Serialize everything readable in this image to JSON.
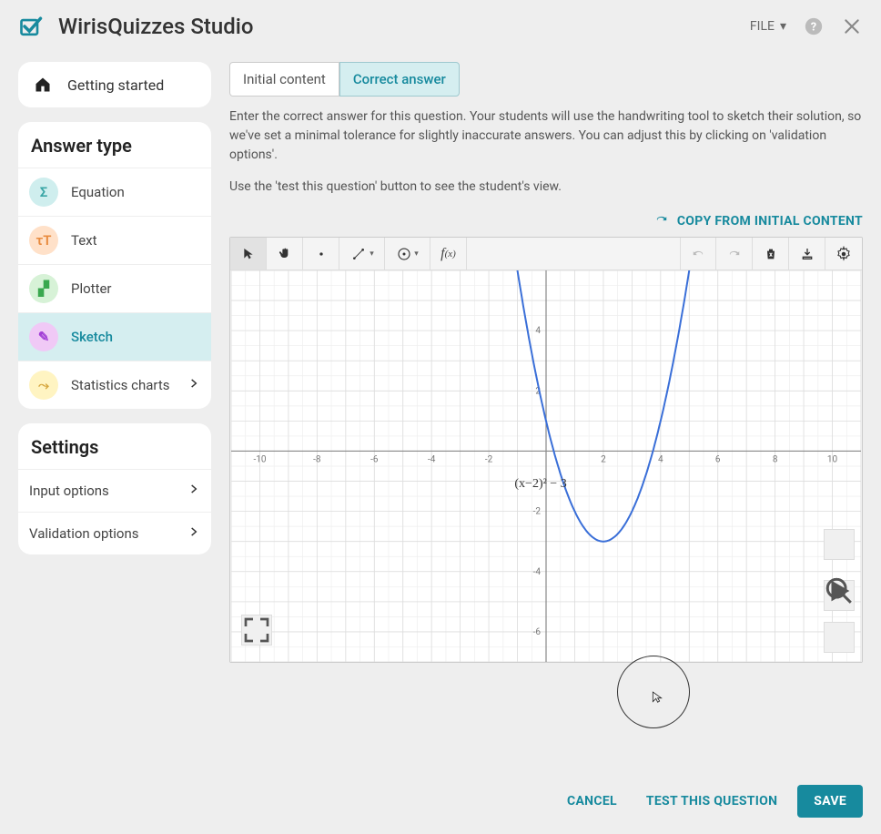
{
  "app_title": "WirisQuizzes Studio",
  "header": {
    "file_label": "FILE"
  },
  "sidebar": {
    "getting_started": "Getting started",
    "answer_type_header": "Answer type",
    "answer_types": [
      {
        "label": "Equation",
        "icon_bg": "#cfeeee",
        "icon_fg": "#3aa6a6",
        "glyph": "Σ"
      },
      {
        "label": "Text",
        "icon_bg": "#ffe1c9",
        "icon_fg": "#e88b3f",
        "glyph": "τT"
      },
      {
        "label": "Plotter",
        "icon_bg": "#d7f2d7",
        "icon_fg": "#3aa84f",
        "glyph": "▞"
      },
      {
        "label": "Sketch",
        "icon_bg": "#f0c9f6",
        "icon_fg": "#a23fd6",
        "glyph": "✎"
      },
      {
        "label": "Statistics charts",
        "icon_bg": "#fff4c2",
        "icon_fg": "#d6a73f",
        "glyph": "⤳"
      }
    ],
    "settings_header": "Settings",
    "settings_items": [
      {
        "label": "Input options"
      },
      {
        "label": "Validation options"
      }
    ]
  },
  "tabs": [
    {
      "label": "Initial content",
      "active": false
    },
    {
      "label": "Correct answer",
      "active": true
    }
  ],
  "instructions": {
    "p1": "Enter the correct answer for this question. Your students will use the handwriting tool to sketch their solution, so we've set a minimal tolerance for slightly inaccurate answers. You can adjust this by clicking on 'validation options'.",
    "p2": "Use the 'test this question' button to see the student's view."
  },
  "copy_label": "COPY FROM INITIAL CONTENT",
  "toolbar": {
    "fx_label": "f(x)"
  },
  "chart_data": {
    "type": "line",
    "title": "",
    "xlabel": "",
    "ylabel": "",
    "xlim": [
      -11,
      11
    ],
    "ylim": [
      -7,
      6
    ],
    "x_ticks": [
      -10,
      -8,
      -6,
      -4,
      -2,
      2,
      4,
      6,
      8,
      10
    ],
    "y_ticks": [
      -6,
      -4,
      -2,
      2,
      4
    ],
    "expression_label": "(x−2)² − 3",
    "expression_label_pos": {
      "x": -1.1,
      "y": -1.2
    },
    "series": [
      {
        "name": "(x-2)^2 - 3",
        "x": [
          -1.0,
          -0.5,
          0.0,
          0.5,
          1.0,
          1.5,
          2.0,
          2.5,
          3.0,
          3.5,
          4.0,
          4.5,
          5.0
        ],
        "y": [
          6.0,
          3.25,
          1.0,
          -0.75,
          -2.0,
          -2.75,
          -3.0,
          -2.75,
          -2.0,
          -0.75,
          1.0,
          3.25,
          6.0
        ]
      }
    ]
  },
  "footer": {
    "cancel": "CANCEL",
    "test": "TEST THIS QUESTION",
    "save": "SAVE"
  }
}
